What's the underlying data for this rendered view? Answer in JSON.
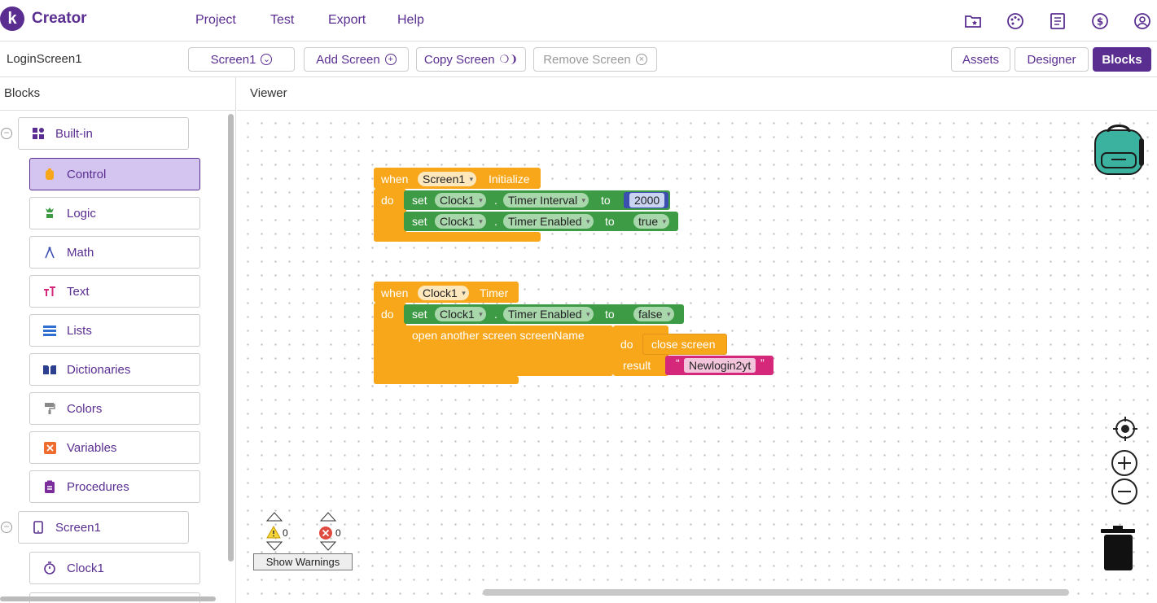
{
  "app": {
    "logo_letter": "k",
    "name": "Creator"
  },
  "menu": [
    "Project",
    "Test",
    "Export",
    "Help"
  ],
  "top_icons": [
    "folder-star-icon",
    "palette-icon",
    "book-icon",
    "dollar-icon",
    "account-icon"
  ],
  "toolbar": {
    "screen_name": "LoginScreen1",
    "screen_select": "Screen1",
    "add_screen": "Add Screen",
    "copy_screen": "Copy Screen",
    "remove_screen": "Remove Screen",
    "assets": "Assets",
    "designer": "Designer",
    "blocks": "Blocks"
  },
  "blocks_panel": {
    "title": "Blocks",
    "builtin": "Built-in",
    "items": [
      "Control",
      "Logic",
      "Math",
      "Text",
      "Lists",
      "Dictionaries",
      "Colors",
      "Variables",
      "Procedures"
    ],
    "screen": "Screen1",
    "components": [
      "Clock1"
    ]
  },
  "viewer": {
    "title": "Viewer",
    "block1": {
      "when": "when",
      "component": "Screen1",
      "event": "Initialize",
      "do": "do",
      "rows": [
        {
          "set": "set",
          "comp": "Clock1",
          "dot": ".",
          "prop": "Timer Interval",
          "to": "to",
          "value": "2000"
        },
        {
          "set": "set",
          "comp": "Clock1",
          "dot": ".",
          "prop": "Timer Enabled",
          "to": "to",
          "value": "true"
        }
      ]
    },
    "block2": {
      "when": "when",
      "component": "Clock1",
      "event": "Timer",
      "do": "do",
      "row": {
        "set": "set",
        "comp": "Clock1",
        "dot": ".",
        "prop": "Timer Enabled",
        "to": "to",
        "value": "false"
      },
      "open": "open another screen  screenName",
      "do2": "do",
      "close": "close screen",
      "result": "result",
      "quote_open": "“",
      "text": "Newlogin2yt",
      "quote_close": "”"
    },
    "warnings": {
      "warn_count": "0",
      "error_count": "0",
      "show": "Show Warnings"
    }
  },
  "colors": {
    "brand": "#5a2e91",
    "event": "#f8a71b",
    "setter": "#3d9b45",
    "math": "#3b4fb0",
    "text": "#d6287a"
  }
}
